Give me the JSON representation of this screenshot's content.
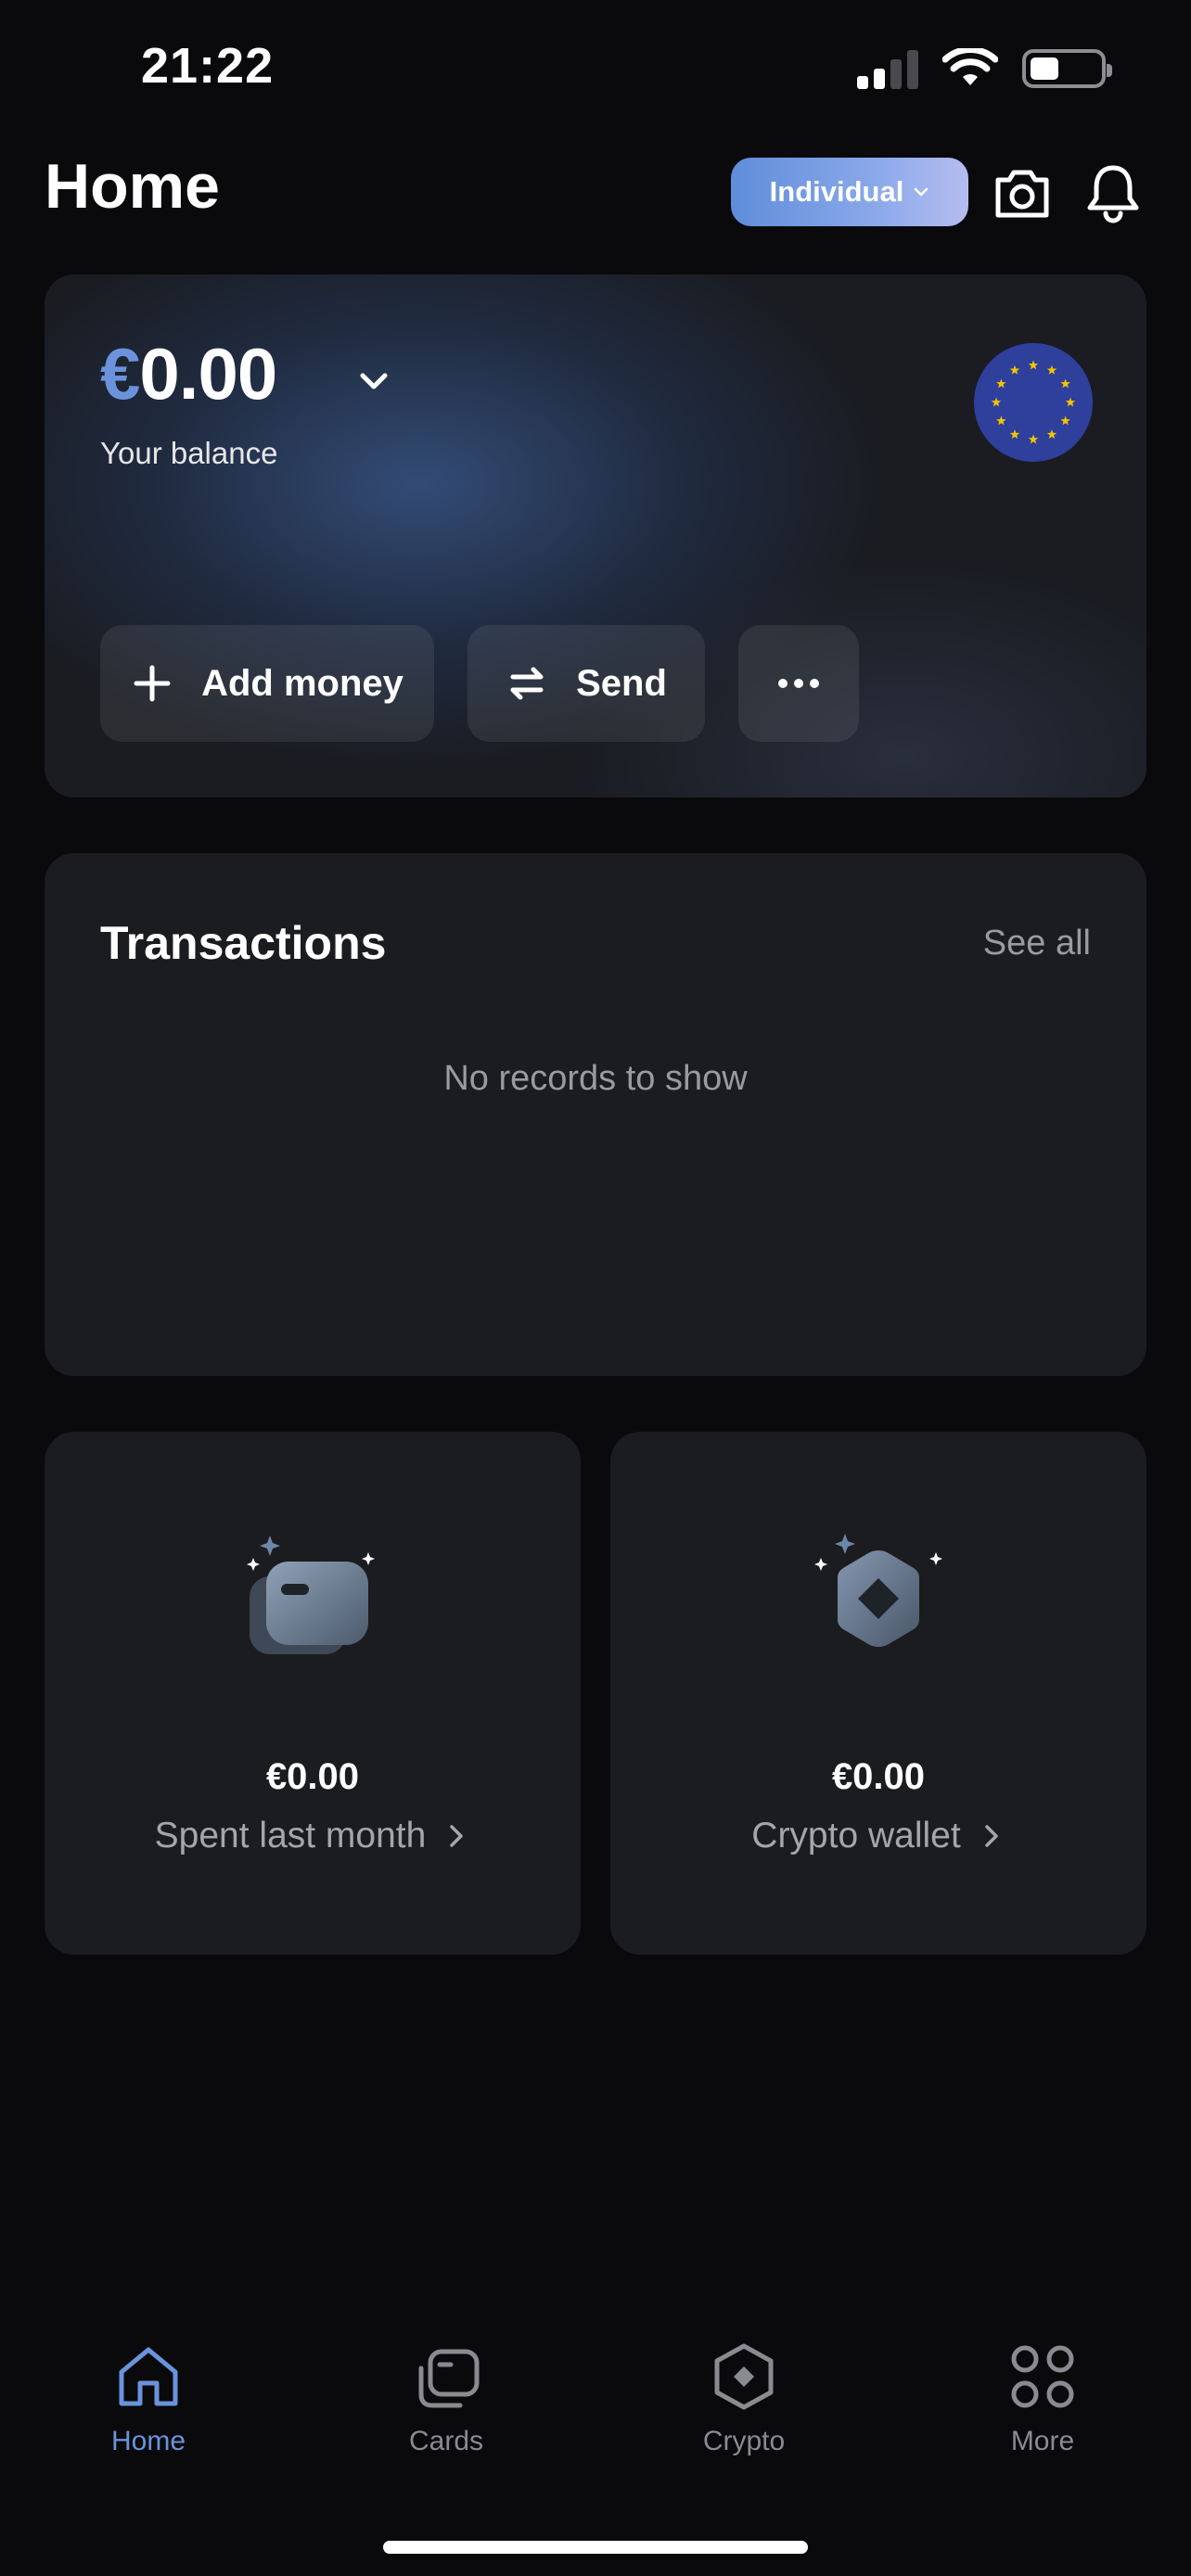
{
  "status_bar": {
    "time": "21:22",
    "icons": [
      "cellular-signal-icon",
      "wifi-icon",
      "battery-icon"
    ],
    "battery_level": 0.42
  },
  "header": {
    "title": "Home",
    "account_type": "Individual",
    "icons": [
      "camera-icon",
      "bell-icon"
    ]
  },
  "balance": {
    "currency_symbol": "€",
    "amount": "0.00",
    "label": "Your balance",
    "currency_flag": "eu-flag-icon",
    "actions": {
      "add_money": "Add money",
      "send": "Send",
      "more_icon": "ellipsis-icon"
    }
  },
  "transactions": {
    "title": "Transactions",
    "see_all": "See all",
    "empty_text": "No records to show"
  },
  "tiles": [
    {
      "amount": "€0.00",
      "label": "Spent last month",
      "icon": "cards-illustration-icon"
    },
    {
      "amount": "€0.00",
      "label": "Crypto wallet",
      "icon": "crypto-illustration-icon"
    }
  ],
  "tabbar": {
    "items": [
      {
        "label": "Home",
        "icon": "home-icon",
        "active": true
      },
      {
        "label": "Cards",
        "icon": "cards-icon",
        "active": false
      },
      {
        "label": "Crypto",
        "icon": "crypto-icon",
        "active": false
      },
      {
        "label": "More",
        "icon": "grid-icon",
        "active": false
      }
    ]
  },
  "colors": {
    "background": "#0a0a0c",
    "surface": "#1b1c1f",
    "accent": "#6a93dc",
    "muted_text": "#9a9ba0",
    "eu_blue": "#2e3f9c",
    "eu_star": "#f2c400"
  }
}
